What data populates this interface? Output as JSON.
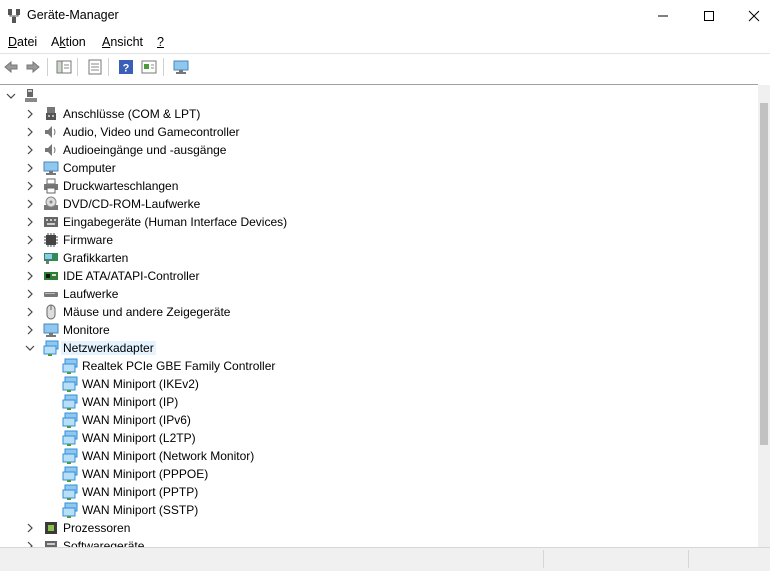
{
  "window": {
    "title": "Geräte-Manager"
  },
  "menu": {
    "file": {
      "key": "D",
      "rest": "atei"
    },
    "action": {
      "pre": "A",
      "key": "k",
      "rest": "tion"
    },
    "view": {
      "key": "A",
      "rest": "nsicht"
    },
    "help": {
      "key": "?"
    }
  },
  "toolbar": [
    "back-icon",
    "forward-icon",
    "show-hide-tree-icon",
    "properties-icon",
    "help-icon",
    "update-driver-icon",
    "scan-hardware-icon"
  ],
  "tree": {
    "root_expanded": true,
    "categories": [
      {
        "label": "Anschlüsse (COM & LPT)",
        "icon": "ports-icon"
      },
      {
        "label": "Audio, Video und Gamecontroller",
        "icon": "speaker-icon"
      },
      {
        "label": "Audioeingänge und -ausgänge",
        "icon": "speaker-icon"
      },
      {
        "label": "Computer",
        "icon": "monitor-icon"
      },
      {
        "label": "Druckwarteschlangen",
        "icon": "printer-icon"
      },
      {
        "label": "DVD/CD-ROM-Laufwerke",
        "icon": "disc-drive-icon"
      },
      {
        "label": "Eingabegeräte (Human Interface Devices)",
        "icon": "hid-icon"
      },
      {
        "label": "Firmware",
        "icon": "chip-icon"
      },
      {
        "label": "Grafikkarten",
        "icon": "display-adapter-icon"
      },
      {
        "label": "IDE ATA/ATAPI-Controller",
        "icon": "ide-controller-icon"
      },
      {
        "label": "Laufwerke",
        "icon": "disk-drive-icon"
      },
      {
        "label": "Mäuse und andere Zeigegeräte",
        "icon": "mouse-icon"
      },
      {
        "label": "Monitore",
        "icon": "monitor-icon"
      },
      {
        "label": "Netzwerkadapter",
        "icon": "network-adapter-icon",
        "expanded": true,
        "selected": true,
        "children": [
          "Realtek PCIe GBE Family Controller",
          "WAN Miniport (IKEv2)",
          "WAN Miniport (IP)",
          "WAN Miniport (IPv6)",
          "WAN Miniport (L2TP)",
          "WAN Miniport (Network Monitor)",
          "WAN Miniport (PPPOE)",
          "WAN Miniport (PPTP)",
          "WAN Miniport (SSTP)"
        ]
      },
      {
        "label": "Prozessoren",
        "icon": "processor-icon"
      },
      {
        "label": "Softwaregeräte",
        "icon": "software-device-icon"
      }
    ]
  },
  "colors": {
    "selection": "#e5f3ff",
    "network": "#2f8fd8"
  }
}
